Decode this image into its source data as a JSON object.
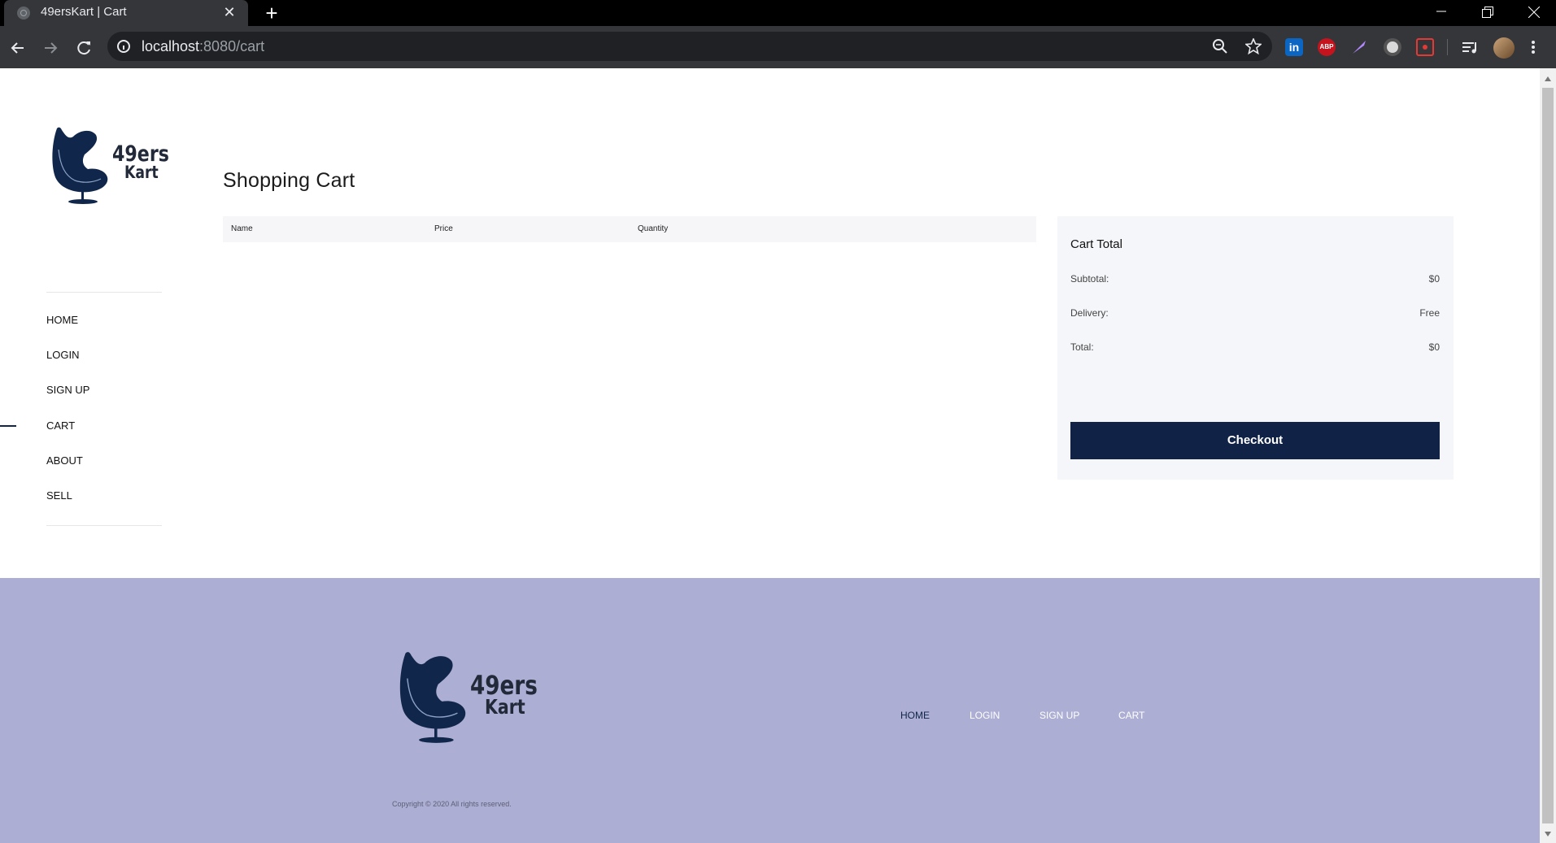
{
  "browser": {
    "tab_title": "49ersKart | Cart",
    "url_host": "localhost",
    "url_rest": ":8080/cart",
    "tab_close": "✕",
    "new_tab": "+",
    "extensions": [
      "linkedin-icon",
      "adblock-icon",
      "pen-icon",
      "circle-icon",
      "record-icon",
      "media-icon"
    ],
    "linkedin_label": "in",
    "adblock_label": "ABP"
  },
  "brand": {
    "line1": "49ers",
    "line2": "Kart",
    "colors": {
      "navy": "#10264a",
      "footer_bg": "#adaed3",
      "button": "#102347"
    }
  },
  "sidebar": {
    "items": [
      {
        "label": "HOME"
      },
      {
        "label": "LOGIN"
      },
      {
        "label": "SIGN UP"
      },
      {
        "label": "CART",
        "active": true
      },
      {
        "label": "ABOUT"
      },
      {
        "label": "SELL"
      }
    ]
  },
  "main": {
    "title": "Shopping Cart",
    "columns": [
      "Name",
      "Price",
      "Quantity"
    ]
  },
  "totals": {
    "title": "Cart Total",
    "subtotal_label": "Subtotal:",
    "subtotal_value": "$0",
    "delivery_label": "Delivery:",
    "delivery_value": "Free",
    "total_label": "Total:",
    "total_value": "$0",
    "checkout_label": "Checkout"
  },
  "footer": {
    "nav": [
      {
        "label": "HOME"
      },
      {
        "label": "LOGIN"
      },
      {
        "label": "SIGN UP"
      },
      {
        "label": "CART"
      }
    ],
    "copyright": "Copyright © 2020 All rights reserved."
  }
}
